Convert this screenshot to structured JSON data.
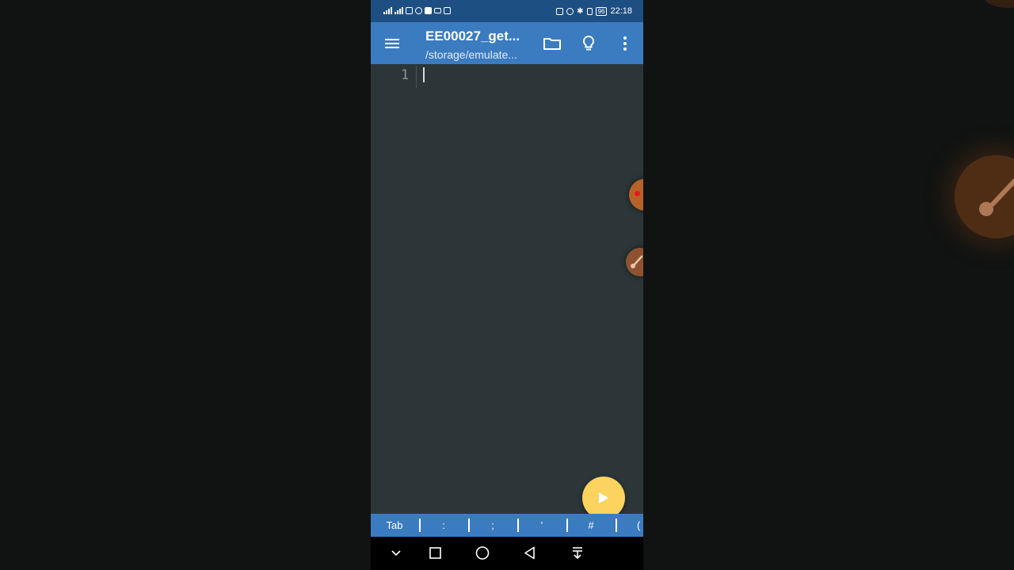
{
  "status_bar": {
    "left_icons": [
      "signal-4g-icon",
      "signal-icon",
      "cast-icon",
      "eye-icon",
      "video-icon",
      "laptop-icon",
      "clipboard-icon"
    ],
    "right_icons": [
      "nfc-icon",
      "alarm-icon",
      "bluetooth-icon",
      "vibrate-icon"
    ],
    "battery": "96",
    "time": "22:18"
  },
  "app_bar": {
    "title": "EE00027_get...",
    "subtitle": "/storage/emulate...",
    "color": "#3b7bc0",
    "icons": [
      "menu-icon",
      "folder-icon",
      "lightbulb-icon",
      "more-vert-icon"
    ]
  },
  "editor": {
    "line_number": "1",
    "content": "",
    "background": "#2c3638"
  },
  "fab": {
    "icon": "play-icon",
    "color": "#fcd35e"
  },
  "symbol_bar": {
    "keys": [
      "Tab",
      ":",
      ";",
      "'",
      "#",
      "("
    ]
  },
  "nav_bar": {
    "icons": [
      "chevron-down-icon",
      "square-icon",
      "circle-icon",
      "back-triangle-icon",
      "notification-pull-icon"
    ]
  }
}
